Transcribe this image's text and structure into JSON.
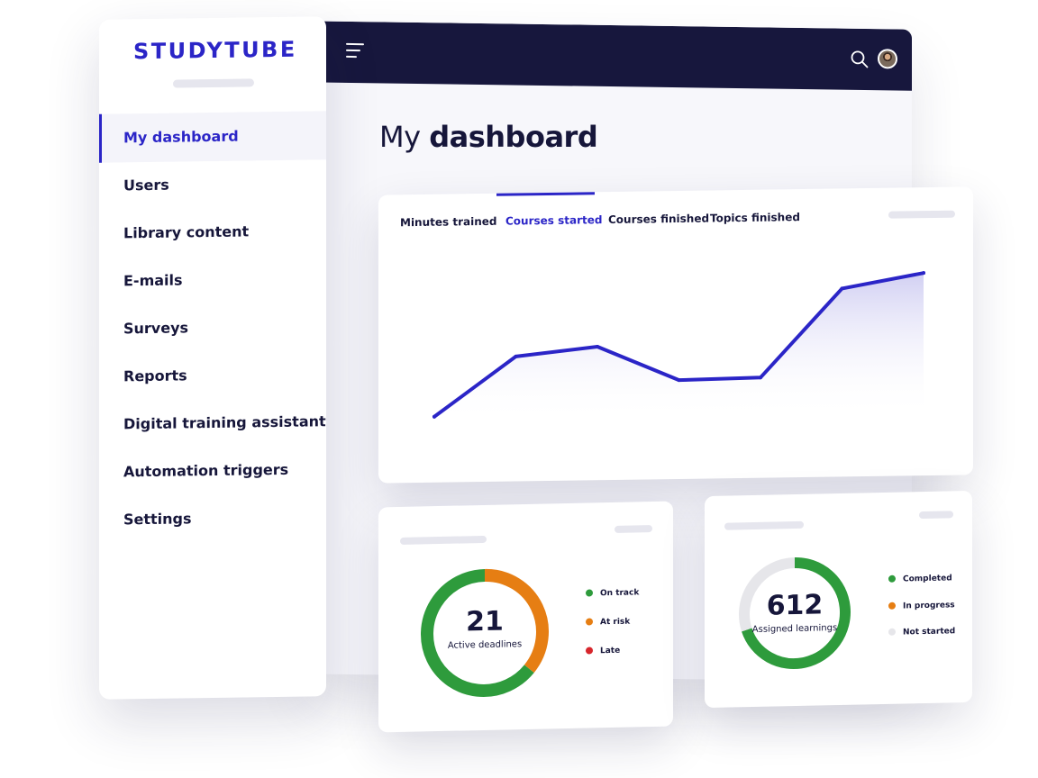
{
  "brand": {
    "logo_text": "STUDYTUBE",
    "brand_color": "#2b25c7",
    "topbar_color": "#17173d"
  },
  "topbar": {
    "menu_icon": "hamburger-menu-icon",
    "search_icon": "search-icon",
    "avatar": "user-avatar"
  },
  "sidebar": {
    "items": [
      {
        "label": "My dashboard",
        "active": true
      },
      {
        "label": "Users"
      },
      {
        "label": "Library content"
      },
      {
        "label": "E-mails"
      },
      {
        "label": "Surveys"
      },
      {
        "label": "Reports"
      },
      {
        "label": "Digital training assistant"
      },
      {
        "label": "Automation triggers"
      },
      {
        "label": "Settings"
      }
    ]
  },
  "page": {
    "title_light": "My",
    "title_bold": "dashboard"
  },
  "chart_tabs": [
    {
      "label": "Minutes trained"
    },
    {
      "label": "Courses started",
      "active": true
    },
    {
      "label": "Courses finished"
    },
    {
      "label": "Topics finished"
    }
  ],
  "chart_data": {
    "type": "area",
    "x": [
      0,
      1,
      2,
      3,
      4,
      5,
      6
    ],
    "values": [
      5,
      46,
      52,
      28,
      29,
      90,
      100
    ],
    "ylim": [
      0,
      100
    ],
    "line_color": "#2b25c7",
    "fill_color": "#d9d7f4",
    "grid": false
  },
  "deadlines_card": {
    "number": "21",
    "label": "Active deadlines",
    "legend": [
      {
        "label": "On track",
        "color": "#2e9b3c"
      },
      {
        "label": "At risk",
        "color": "#e67e13"
      },
      {
        "label": "Late",
        "color": "#d7262c"
      }
    ],
    "segments": [
      {
        "name": "On track",
        "fraction": 0.64,
        "color": "#2e9b3c"
      },
      {
        "name": "At risk",
        "fraction": 0.36,
        "color": "#e67e13"
      }
    ]
  },
  "learnings_card": {
    "number": "612",
    "label": "Assigned learnings",
    "legend": [
      {
        "label": "Completed",
        "color": "#2e9b3c"
      },
      {
        "label": "In progress",
        "color": "#e67e13"
      },
      {
        "label": "Not started",
        "color": "#e6e6ea"
      }
    ],
    "segments": [
      {
        "name": "Completed",
        "fraction": 0.7,
        "color": "#2e9b3c"
      },
      {
        "name": "Not started",
        "fraction": 0.3,
        "color": "#e6e6ea"
      }
    ]
  }
}
